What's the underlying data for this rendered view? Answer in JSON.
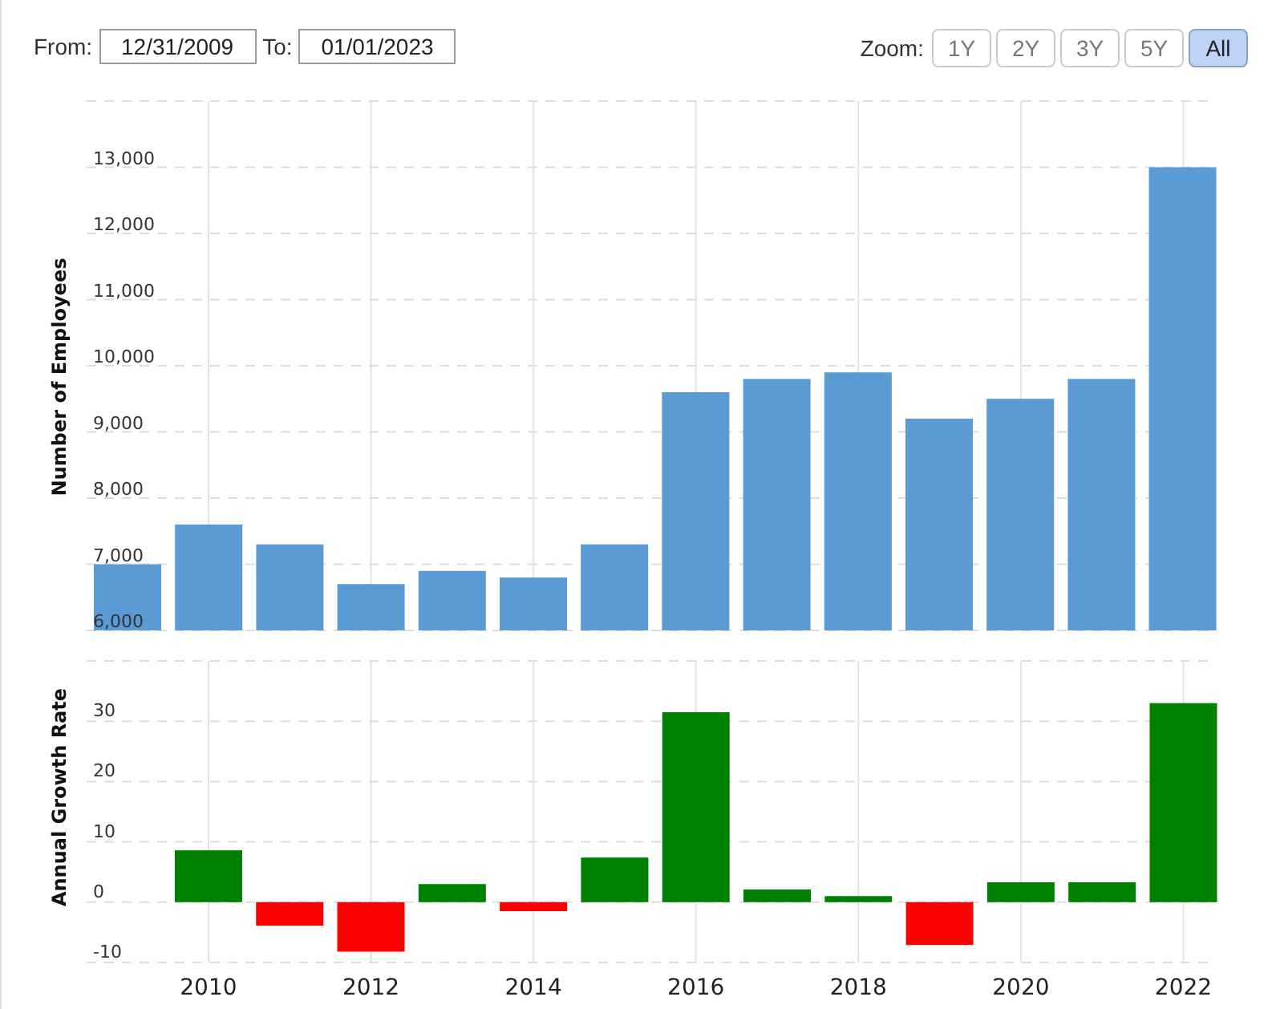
{
  "range": {
    "from_label": "From:",
    "from": "12/31/2009",
    "to_label": "To:",
    "to": "01/01/2023"
  },
  "zoom": {
    "label": "Zoom:",
    "buttons": [
      {
        "label": "1Y",
        "selected": false
      },
      {
        "label": "2Y",
        "selected": false
      },
      {
        "label": "3Y",
        "selected": false
      },
      {
        "label": "5Y",
        "selected": false
      },
      {
        "label": "All",
        "selected": true
      }
    ]
  },
  "employees": {
    "chart_data": {
      "type": "bar",
      "ylabel": "Number of Employees",
      "grid": true,
      "ylim": [
        6000,
        14000
      ],
      "yticks": [
        {
          "value": 6000,
          "label": "6,000"
        },
        {
          "value": 7000,
          "label": "7,000"
        },
        {
          "value": 8000,
          "label": "8,000"
        },
        {
          "value": 9000,
          "label": "9,000"
        },
        {
          "value": 10000,
          "label": "10,000"
        },
        {
          "value": 11000,
          "label": "11,000"
        },
        {
          "value": 12000,
          "label": "12,000"
        },
        {
          "value": 13000,
          "label": "13,000"
        }
      ],
      "series": [
        {
          "color": "#5b9bd5",
          "values": [
            7000,
            7600,
            7300,
            6700,
            6900,
            6800,
            7300,
            9600,
            9800,
            9900,
            9200,
            9500,
            9800,
            13000
          ]
        }
      ]
    }
  },
  "growth": {
    "chart_data": {
      "type": "bar",
      "ylabel": "Annual Growth Rate",
      "grid": true,
      "x": [
        2010,
        2011,
        2012,
        2013,
        2014,
        2015,
        2016,
        2017,
        2018,
        2019,
        2020,
        2021,
        2022
      ],
      "xlim": [
        2008.5,
        2022.4
      ],
      "ylim": [
        -10,
        40
      ],
      "yticks": [
        -10,
        0,
        10,
        20,
        30
      ],
      "xticks": [
        2010,
        2012,
        2014,
        2016,
        2018,
        2020,
        2022
      ],
      "series": [
        {
          "values": [
            8.6,
            -3.9,
            -8.2,
            3,
            -1.5,
            7.4,
            31.5,
            2.1,
            1,
            -7.1,
            3.3,
            3.3,
            33
          ]
        }
      ]
    }
  }
}
